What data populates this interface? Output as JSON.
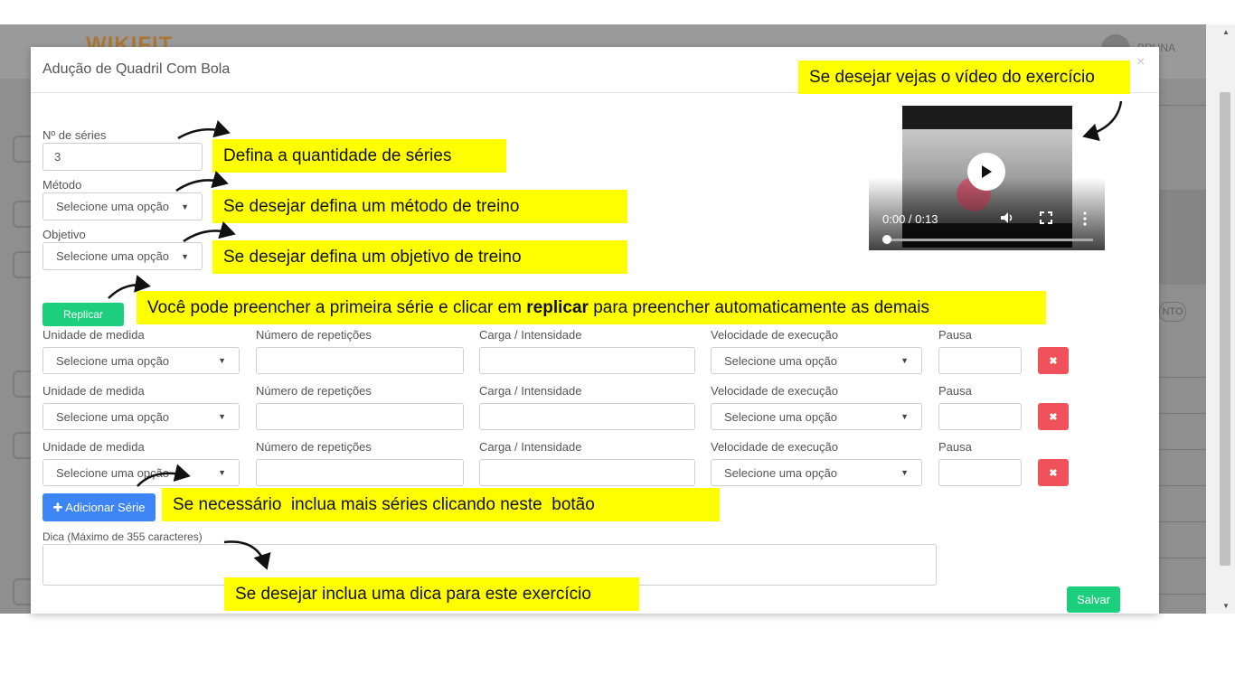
{
  "background": {
    "logo": "WIKIFIT",
    "user_name": "BRUNA",
    "badge": "NTO"
  },
  "modal": {
    "title": "Adução de Quadril Com Bola",
    "close": "×"
  },
  "form": {
    "series_label": "Nº de séries",
    "series_value": "3",
    "method_label": "Método",
    "method_value": "Selecione uma opção",
    "objective_label": "Objetivo",
    "objective_value": "Selecione uma opção",
    "replicate_button": "Replicar",
    "columns": {
      "unit": "Unidade de medida",
      "reps": "Número de repetições",
      "load": "Carga / Intensidade",
      "speed": "Velocidade de execução",
      "pause": "Pausa"
    },
    "rows": [
      {
        "unit": "Selecione uma opção",
        "reps": "",
        "load": "",
        "speed": "Selecione uma opção",
        "pause": ""
      },
      {
        "unit": "Selecione uma opção",
        "reps": "",
        "load": "",
        "speed": "Selecione uma opção",
        "pause": ""
      },
      {
        "unit": "Selecione uma opção",
        "reps": "",
        "load": "",
        "speed": "Selecione uma opção",
        "pause": ""
      }
    ],
    "delete_icon": "✖",
    "add_series_button": "✚ Adicionar Série",
    "tip_label": "Dica (Máximo de 355 caracteres)",
    "tip_value": "",
    "save_button": "Salvar"
  },
  "video": {
    "time": "0:00 / 0:13",
    "progress": 0
  },
  "annotations": {
    "video": "Se desejar vejas o vídeo do exercício",
    "series": "Defina a quantidade de séries",
    "method": "Se desejar defina um método de treino",
    "objective": "Se desejar defina um objetivo de treino",
    "replicate_pre": "Você pode preencher a primeira série e clicar em ",
    "replicate_bold": "replicar",
    "replicate_post": " para preencher automaticamente as demais",
    "add_series": "Se necessário  inclua mais séries clicando neste  botão",
    "tip": "Se desejar inclua uma dica para este exercício"
  },
  "colors": {
    "highlight": "#ffff00",
    "green": "#1ccf7d",
    "blue": "#3d84f5",
    "red": "#f0525b"
  }
}
